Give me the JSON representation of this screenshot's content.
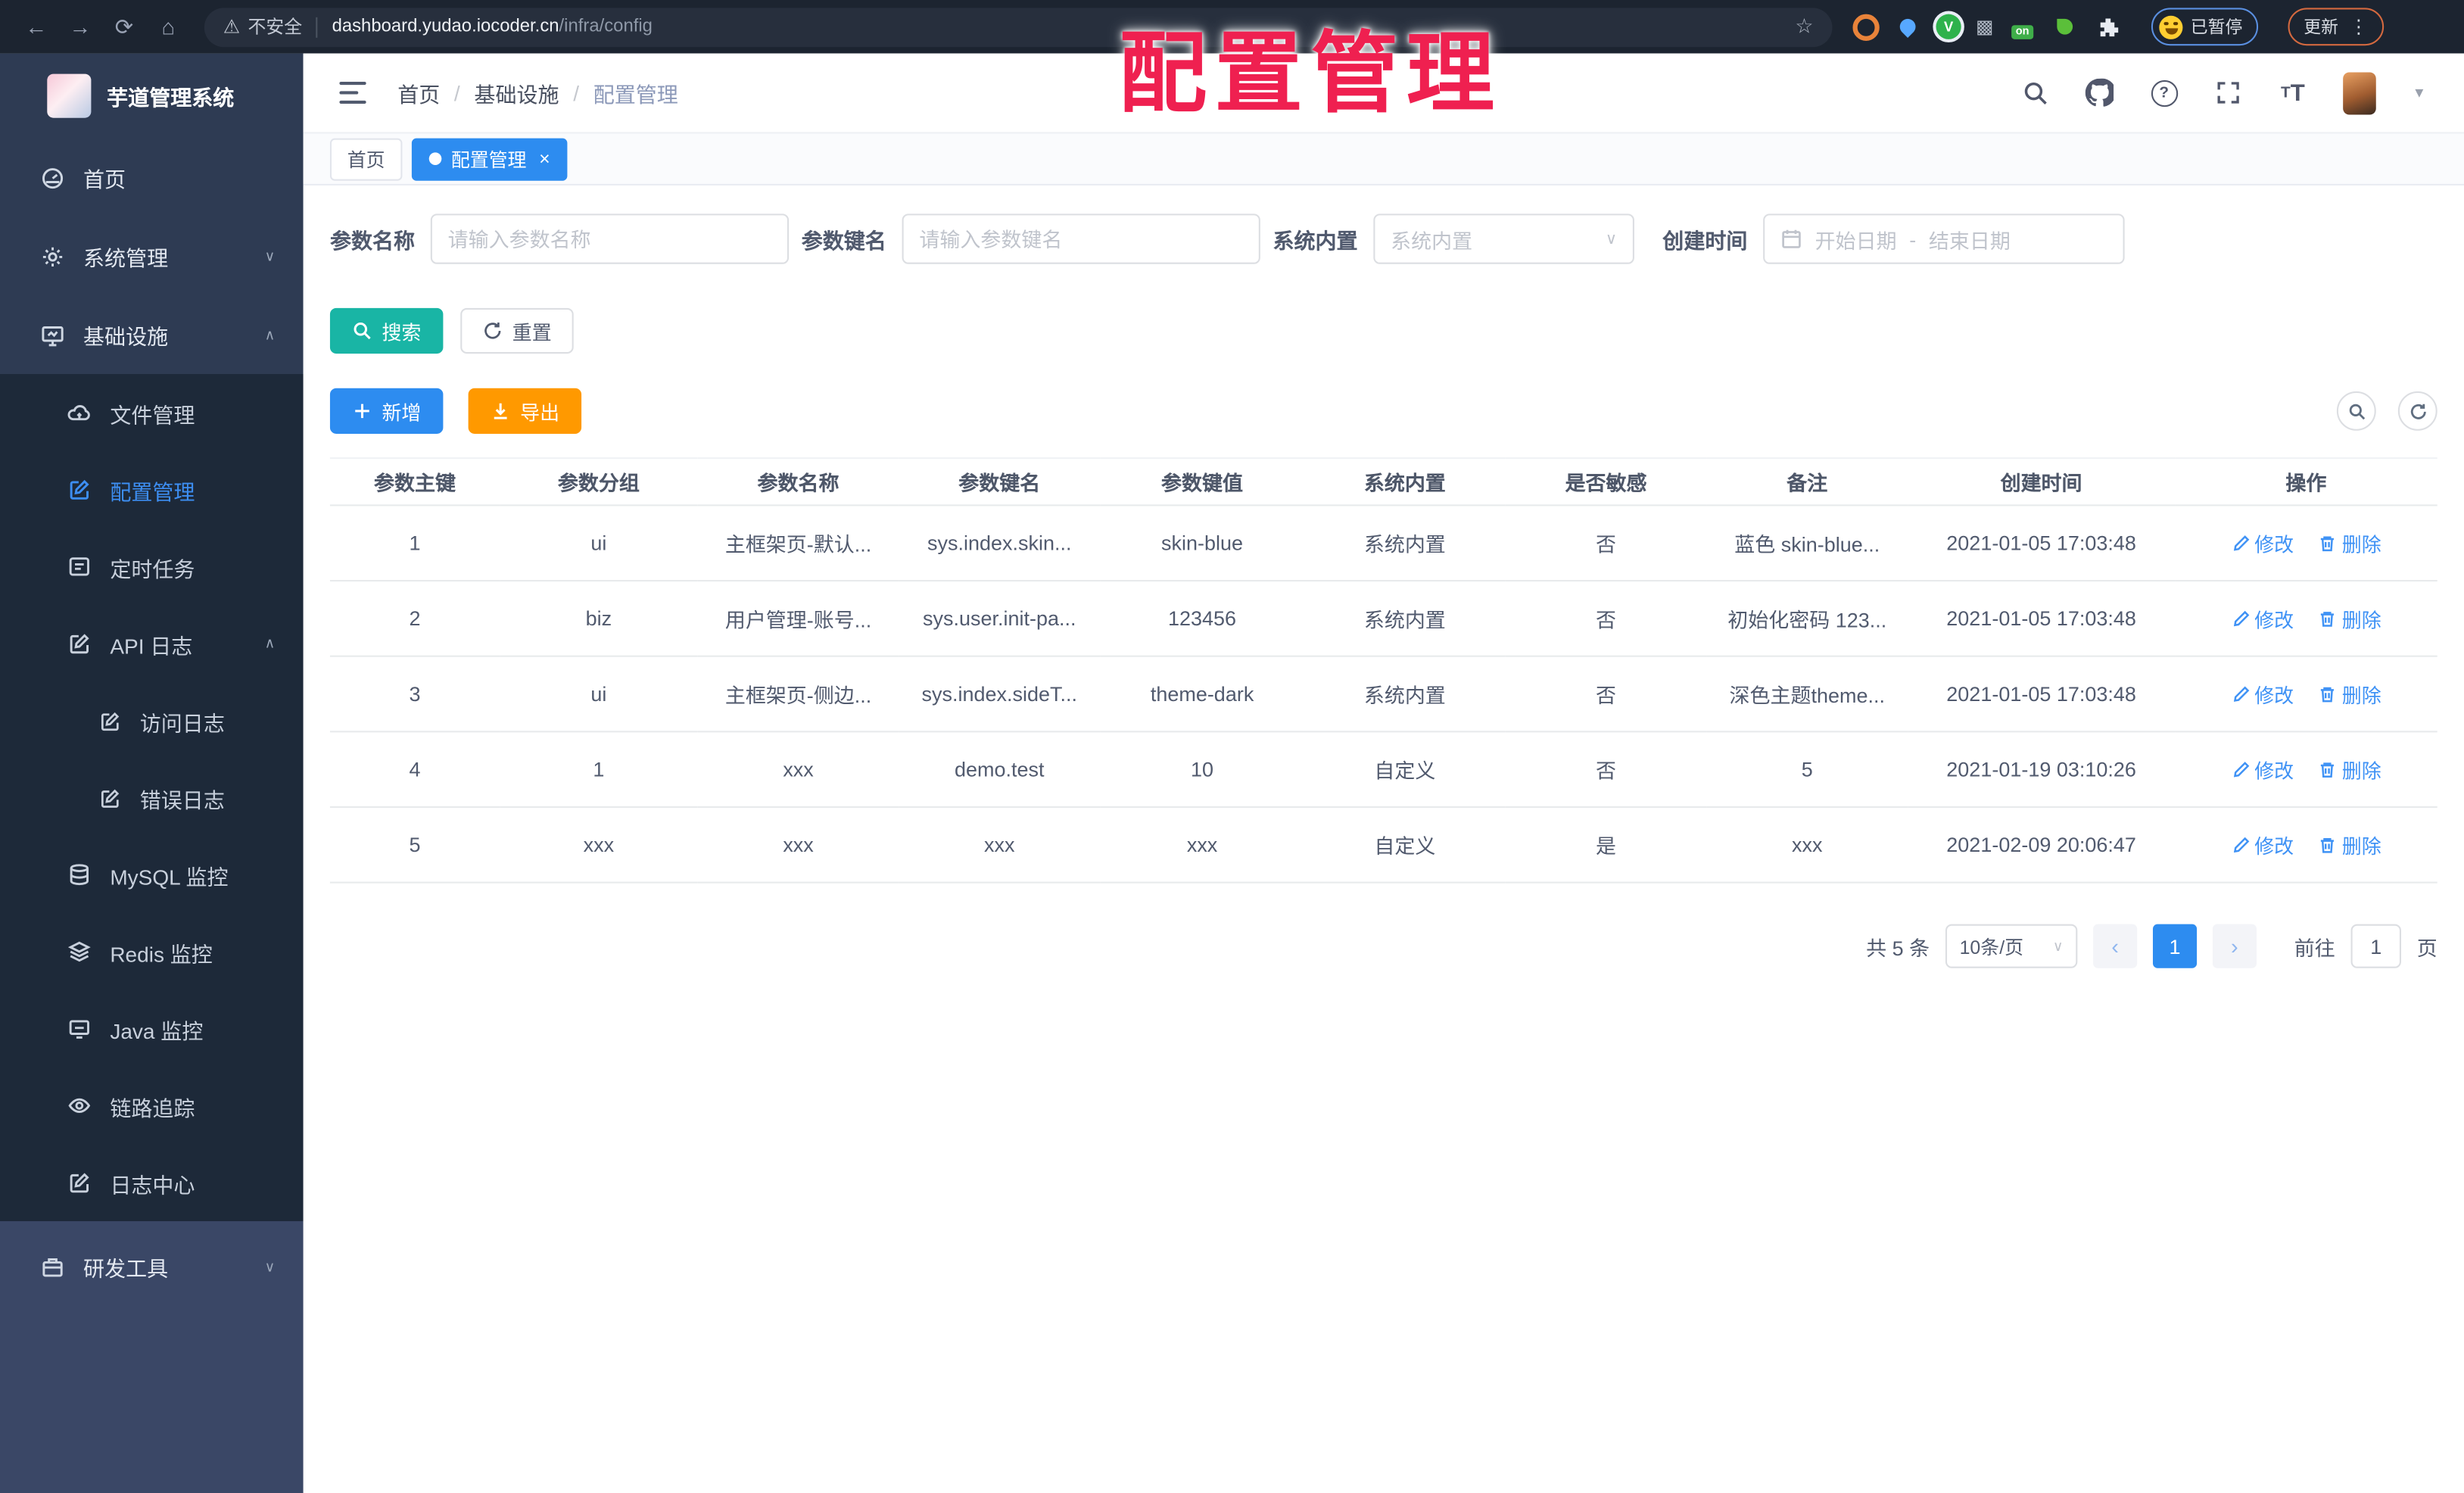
{
  "browser": {
    "security_label": "不安全",
    "url_host": "dashboard.yudao.iocoder.cn",
    "url_path": "/infra/config",
    "extensions": {
      "v_badge": "V",
      "on_badge": "on"
    },
    "paused_label": "已暂停",
    "update_label": "更新"
  },
  "annotation": {
    "text": "配置管理",
    "color": "#ef2050"
  },
  "sidebar": {
    "title": "芋道管理系统",
    "top_items": [
      {
        "label": "首页",
        "icon": "dashboard-icon"
      },
      {
        "label": "系统管理",
        "icon": "gear-icon",
        "chevron": "down"
      },
      {
        "label": "基础设施",
        "icon": "monitor-icon",
        "chevron": "up"
      }
    ],
    "submenu": [
      {
        "label": "文件管理",
        "icon": "cloud-icon"
      },
      {
        "label": "配置管理",
        "icon": "edit-icon",
        "active": true
      },
      {
        "label": "定时任务",
        "icon": "task-icon"
      },
      {
        "label": "API 日志",
        "icon": "edit-icon",
        "chevron": "up"
      },
      {
        "label": "访问日志",
        "icon": "edit-icon",
        "nested": true
      },
      {
        "label": "错误日志",
        "icon": "edit-icon",
        "nested": true
      },
      {
        "label": "MySQL 监控",
        "icon": "database-icon"
      },
      {
        "label": "Redis 监控",
        "icon": "stack-icon"
      },
      {
        "label": "Java 监控",
        "icon": "screen-icon"
      },
      {
        "label": "链路追踪",
        "icon": "eye-icon"
      },
      {
        "label": "日志中心",
        "icon": "edit-icon"
      }
    ],
    "bottom_items": [
      {
        "label": "研发工具",
        "icon": "briefcase-icon",
        "chevron": "down"
      }
    ]
  },
  "header": {
    "breadcrumb": [
      "首页",
      "基础设施",
      "配置管理"
    ]
  },
  "tabs": [
    {
      "label": "首页"
    },
    {
      "label": "配置管理",
      "active": true
    }
  ],
  "filters": {
    "name_label": "参数名称",
    "name_placeholder": "请输入参数名称",
    "key_label": "参数键名",
    "key_placeholder": "请输入参数键名",
    "type_label": "系统内置",
    "type_placeholder": "系统内置",
    "date_label": "创建时间",
    "date_start": "开始日期",
    "date_sep": "-",
    "date_end": "结束日期",
    "search_label": "搜索",
    "reset_label": "重置",
    "add_label": "新增",
    "export_label": "导出"
  },
  "table": {
    "columns": [
      "参数主键",
      "参数分组",
      "参数名称",
      "参数键名",
      "参数键值",
      "系统内置",
      "是否敏感",
      "备注",
      "创建时间",
      "操作"
    ],
    "edit_label": "修改",
    "delete_label": "删除",
    "rows": [
      [
        "1",
        "ui",
        "主框架页-默认...",
        "sys.index.skin...",
        "skin-blue",
        "系统内置",
        "否",
        "蓝色 skin-blue...",
        "2021-01-05 17:03:48"
      ],
      [
        "2",
        "biz",
        "用户管理-账号...",
        "sys.user.init-pa...",
        "123456",
        "系统内置",
        "否",
        "初始化密码 123...",
        "2021-01-05 17:03:48"
      ],
      [
        "3",
        "ui",
        "主框架页-侧边...",
        "sys.index.sideT...",
        "theme-dark",
        "系统内置",
        "否",
        "深色主题theme...",
        "2021-01-05 17:03:48"
      ],
      [
        "4",
        "1",
        "xxx",
        "demo.test",
        "10",
        "自定义",
        "否",
        "5",
        "2021-01-19 03:10:26"
      ],
      [
        "5",
        "xxx",
        "xxx",
        "xxx",
        "xxx",
        "自定义",
        "是",
        "xxx",
        "2021-02-09 20:06:47"
      ]
    ]
  },
  "pagination": {
    "total_label": "共 5 条",
    "page_size_label": "10条/页",
    "current_page": "1",
    "goto_label": "前往",
    "goto_value": "1",
    "page_unit": "页"
  },
  "colors": {
    "primary": "#2d8cf0",
    "teal": "#19b5a5",
    "warning": "#ff9900",
    "sidebar": "#2e3b53",
    "submenu": "#1d2939",
    "annotation": "#ef2050"
  }
}
